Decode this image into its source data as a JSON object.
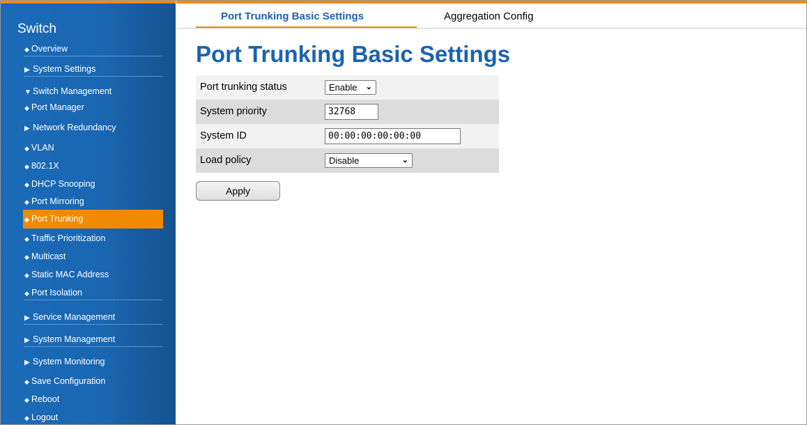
{
  "sidebar": {
    "title": "Switch",
    "items": [
      {
        "label": "Overview",
        "marker": "◆"
      },
      {
        "label": "System Settings",
        "marker": "▶"
      },
      {
        "label": "Switch Management",
        "marker": "▼"
      },
      {
        "label": "Port Manager",
        "marker": "◆"
      },
      {
        "label": "Network Redundancy",
        "marker": "▶"
      },
      {
        "label": "VLAN",
        "marker": "◆"
      },
      {
        "label": "802.1X",
        "marker": "◆"
      },
      {
        "label": "DHCP Snooping",
        "marker": "◆"
      },
      {
        "label": "Port Mirroring",
        "marker": "◆"
      },
      {
        "label": "Port Trunking",
        "marker": "◆"
      },
      {
        "label": "Traffic Prioritization",
        "marker": "◆"
      },
      {
        "label": "Multicast",
        "marker": "◆"
      },
      {
        "label": "Static MAC Address",
        "marker": "◆"
      },
      {
        "label": "Port Isolation",
        "marker": "◆"
      },
      {
        "label": "Service Management",
        "marker": "▶"
      },
      {
        "label": "System Management",
        "marker": "▶"
      },
      {
        "label": "System Monitoring",
        "marker": "▶"
      },
      {
        "label": "Save Configuration",
        "marker": "◆"
      },
      {
        "label": "Reboot",
        "marker": "◆"
      },
      {
        "label": "Logout",
        "marker": "◆"
      }
    ],
    "active_item": "Port Trunking"
  },
  "tabs": {
    "basic": "Port Trunking Basic Settings",
    "aggregation": "Aggregation Config"
  },
  "main": {
    "title": "Port Trunking Basic Settings",
    "fields": {
      "status_label": "Port trunking status",
      "status_value": "Enable",
      "priority_label": "System priority",
      "priority_value": "32768",
      "sysid_label": "System ID",
      "sysid_value": "00:00:00:00:00:00",
      "policy_label": "Load policy",
      "policy_value": "Disable"
    },
    "apply_label": "Apply"
  },
  "colors": {
    "accent": "#f28a00",
    "sidebar_blue": "#1b6bb8",
    "title_blue": "#1b63b0"
  }
}
